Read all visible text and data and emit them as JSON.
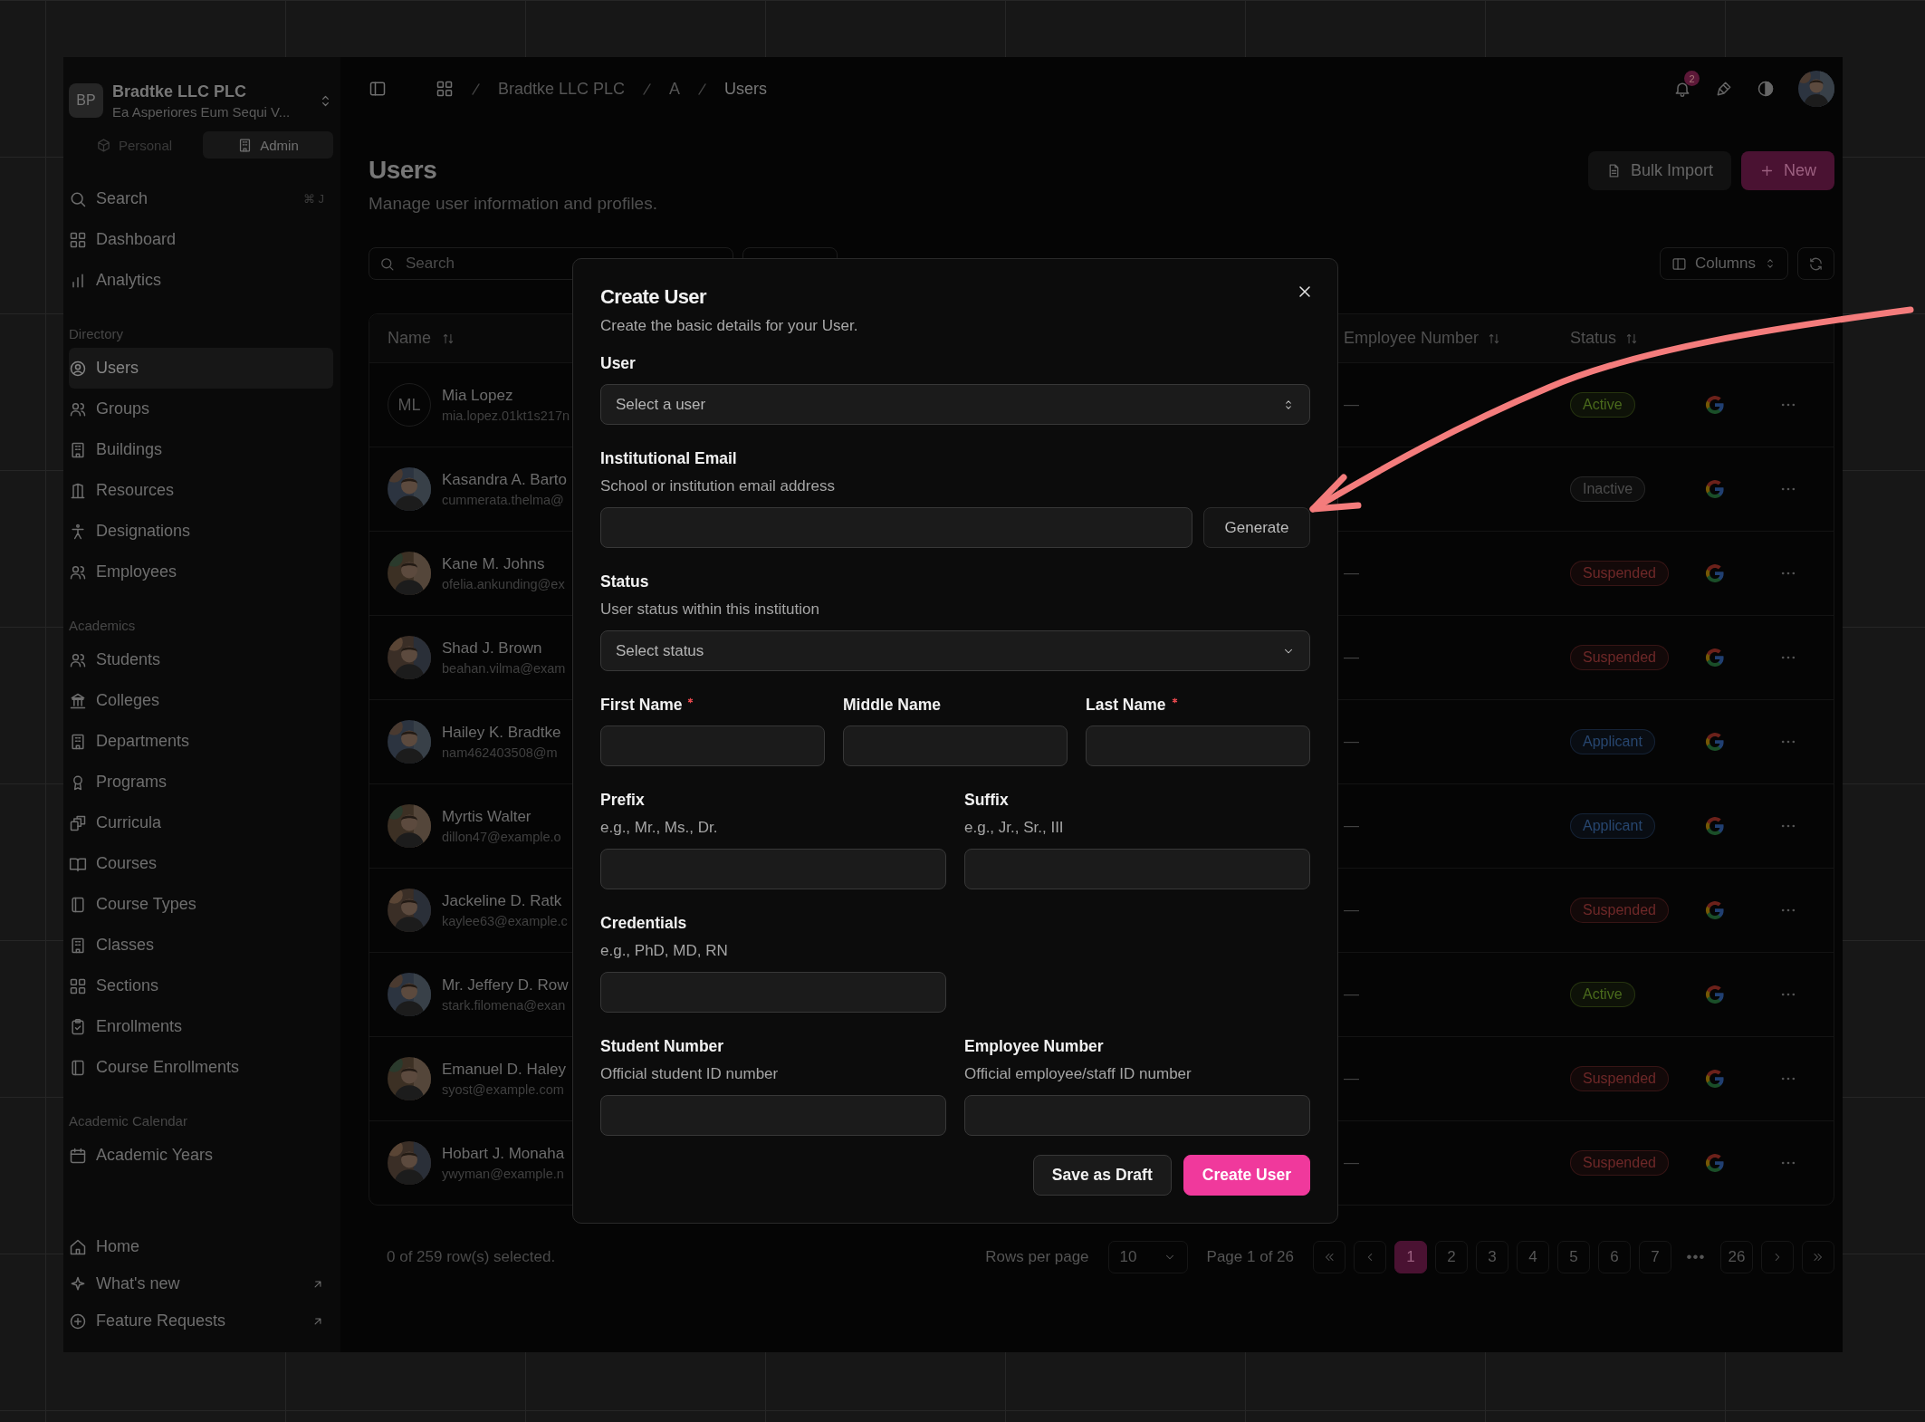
{
  "sidebar": {
    "org": {
      "initials": "BP",
      "name": "Bradtke LLC PLC",
      "subtitle": "Ea Asperiores Eum Sequi V..."
    },
    "modes": [
      {
        "label": "Personal",
        "selected": false
      },
      {
        "label": "Admin",
        "selected": true
      }
    ],
    "sections": [
      {
        "items": [
          {
            "label": "Search",
            "shortcut": "⌘ J",
            "selected": false
          },
          {
            "label": "Dashboard",
            "selected": false
          },
          {
            "label": "Analytics",
            "selected": false
          }
        ]
      },
      {
        "title": "Directory",
        "items": [
          {
            "label": "Users",
            "selected": true
          },
          {
            "label": "Groups",
            "selected": false
          },
          {
            "label": "Buildings",
            "selected": false
          },
          {
            "label": "Resources",
            "selected": false
          },
          {
            "label": "Designations",
            "selected": false
          },
          {
            "label": "Employees",
            "selected": false
          }
        ]
      },
      {
        "title": "Academics",
        "items": [
          {
            "label": "Students",
            "selected": false
          },
          {
            "label": "Colleges",
            "selected": false
          },
          {
            "label": "Departments",
            "selected": false
          },
          {
            "label": "Programs",
            "selected": false
          },
          {
            "label": "Curricula",
            "selected": false
          },
          {
            "label": "Courses",
            "selected": false
          },
          {
            "label": "Course Types",
            "selected": false
          },
          {
            "label": "Classes",
            "selected": false
          },
          {
            "label": "Sections",
            "selected": false
          },
          {
            "label": "Enrollments",
            "selected": false
          },
          {
            "label": "Course Enrollments",
            "selected": false
          }
        ]
      },
      {
        "title": "Academic Calendar",
        "items": [
          {
            "label": "Academic Years",
            "selected": false
          }
        ]
      }
    ],
    "footer_items": [
      {
        "label": "Home",
        "external": false
      },
      {
        "label": "What's new",
        "external": true
      },
      {
        "label": "Feature Requests",
        "external": true
      }
    ]
  },
  "header": {
    "breadcrumb": [
      {
        "label": "Bradtke LLC PLC",
        "current": false
      },
      {
        "label": "A",
        "current": false
      },
      {
        "label": "Users",
        "current": true
      }
    ],
    "notifications": "2"
  },
  "page": {
    "title": "Users",
    "subtitle": "Manage user information and profiles.",
    "actions": [
      {
        "label": "Bulk Import",
        "kind": "secondary"
      },
      {
        "label": "New",
        "kind": "primary"
      }
    ]
  },
  "toolbar": {
    "search": {
      "placeholder": "Search"
    },
    "columns_button": "Columns"
  },
  "table": {
    "columns": [
      {
        "label": "Name"
      },
      {
        "label": "Employee Number"
      },
      {
        "label": "Status"
      }
    ],
    "rows": [
      {
        "name": "Mia Lopez",
        "email": "mia.lopez.01kt1s217n",
        "avatar": {
          "kind": "initials",
          "text": "ML"
        },
        "employee_number": "—",
        "status": "Active",
        "color": "#4a6a1c"
      },
      {
        "name": "Kasandra A. Barto",
        "email": "cummerata.thelma@",
        "status": "Inactive",
        "color": "#4c4c4c"
      },
      {
        "name": "Kane M. Johns",
        "email": "ofelia.ankunding@ex",
        "employee_number": "—",
        "status": "Suspended",
        "color": "#6e2828"
      },
      {
        "name": "Shad J. Brown",
        "email": "beahan.vilma@exam",
        "employee_number": "—",
        "status": "Suspended",
        "color": "#6e2828"
      },
      {
        "name": "Hailey K. Bradtke",
        "email": "nam462403508@m",
        "employee_number": "—",
        "status": "Applicant",
        "color": "#27466f"
      },
      {
        "name": "Myrtis Walter",
        "email": "dillon47@example.o",
        "employee_number": "—",
        "status": "Applicant",
        "color": "#27466f"
      },
      {
        "name": "Jackeline D. Ratk",
        "email": "kaylee63@example.c",
        "employee_number": "—",
        "status": "Suspended",
        "color": "#6e2828"
      },
      {
        "name": "Mr. Jeffery D. Row",
        "email": "stark.filomena@exan",
        "employee_number": "—",
        "status": "Active",
        "color": "#4a6a1c"
      },
      {
        "name": "Emanuel D. Haley",
        "email": "syost@example.com",
        "employee_number": "—",
        "status": "Suspended",
        "color": "#6e2828"
      },
      {
        "name": "Hobart J. Monaha",
        "email": "ywyman@example.n",
        "employee_number": "—",
        "status": "Suspended",
        "color": "#6e2828"
      }
    ]
  },
  "pagination": {
    "selection": "0 of 259 row(s) selected.",
    "rows_per_page_label": "Rows per page",
    "rows_per_page": "10",
    "page_label": "Page 1 of 26",
    "pages": [
      {
        "label": "1",
        "kind": "page",
        "selected": true
      },
      {
        "label": "2",
        "kind": "page",
        "selected": false
      },
      {
        "label": "3",
        "kind": "page",
        "selected": false
      },
      {
        "label": "4",
        "kind": "page",
        "selected": false
      },
      {
        "label": "5",
        "kind": "page",
        "selected": false
      },
      {
        "label": "6",
        "kind": "page",
        "selected": false
      },
      {
        "label": "7",
        "kind": "page",
        "selected": false
      },
      {
        "label": "•••",
        "kind": "ellipsis"
      },
      {
        "label": "26",
        "kind": "page",
        "selected": false
      }
    ]
  },
  "dialog": {
    "title": "Create User",
    "description": "Create the basic details for your User.",
    "rows": [
      {
        "fields": [
          {
            "kind": "combobox",
            "label": "User",
            "placeholder": "Select a user",
            "required": false
          }
        ]
      },
      {
        "fields": [
          {
            "kind": "input_button",
            "label": "Institutional Email",
            "description": "School or institution email address",
            "button": "Generate",
            "required": false
          }
        ]
      },
      {
        "fields": [
          {
            "kind": "select",
            "label": "Status",
            "description": "User status within this institution",
            "placeholder": "Select status",
            "required": false
          }
        ]
      },
      {
        "fields": [
          {
            "kind": "input",
            "label": "First Name",
            "required": true
          },
          {
            "kind": "input",
            "label": "Middle Name",
            "required": false
          },
          {
            "kind": "input",
            "label": "Last Name",
            "required": true
          }
        ]
      },
      {
        "fields": [
          {
            "kind": "input",
            "label": "Prefix",
            "description": "e.g., Mr., Ms., Dr.",
            "required": false
          },
          {
            "kind": "input",
            "label": "Suffix",
            "description": "e.g., Jr., Sr., III",
            "required": false
          }
        ]
      },
      {
        "fields": [
          {
            "kind": "input",
            "label": "Credentials",
            "description": "e.g., PhD, MD, RN",
            "required": false
          }
        ]
      },
      {
        "fields": [
          {
            "kind": "input",
            "label": "Student Number",
            "description": "Official student ID number",
            "required": false
          },
          {
            "kind": "input",
            "label": "Employee Number",
            "description": "Official employee/staff ID number",
            "required": false
          }
        ]
      }
    ],
    "actions": [
      {
        "label": "Save as Draft",
        "kind": "secondary"
      },
      {
        "label": "Create User",
        "kind": "primary"
      }
    ]
  }
}
